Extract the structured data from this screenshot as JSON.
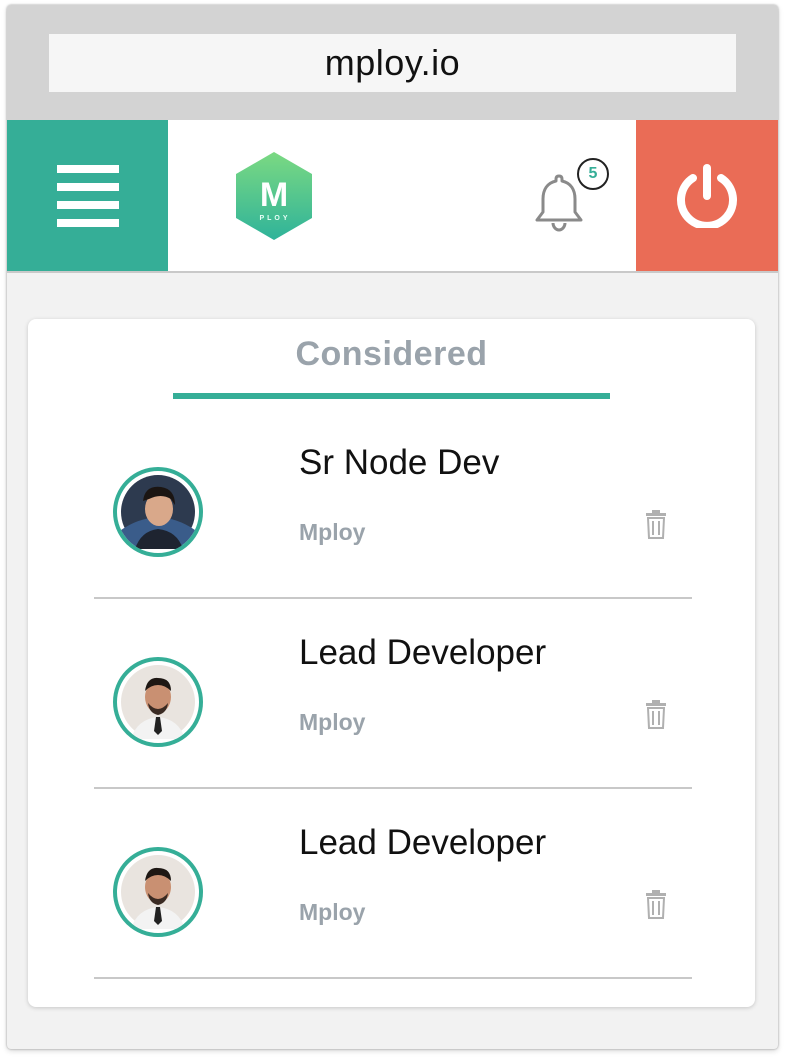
{
  "browser": {
    "url": "mploy.io"
  },
  "header": {
    "menu_icon": "hamburger-menu-icon",
    "logo_text": "M",
    "logo_subtext": "PLOY",
    "notifications_icon": "bell-icon",
    "notification_count": "5",
    "power_icon": "power-icon"
  },
  "colors": {
    "accent": "#35ae97",
    "danger": "#ea6c56",
    "muted": "#9aa3ab"
  },
  "tab": {
    "label": "Considered"
  },
  "items": [
    {
      "title": "Sr Node Dev",
      "company": "Mploy",
      "delete_icon": "trash-icon"
    },
    {
      "title": "Lead Developer",
      "company": "Mploy",
      "delete_icon": "trash-icon"
    },
    {
      "title": "Lead Developer",
      "company": "Mploy",
      "delete_icon": "trash-icon"
    }
  ]
}
